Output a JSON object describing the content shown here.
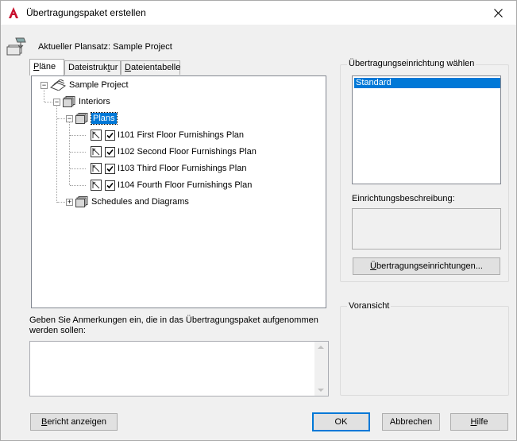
{
  "window": {
    "title": "Übertragungspaket erstellen",
    "accent": "#0078d7",
    "app_icon_color": "#c8102e"
  },
  "header": {
    "label": "Aktueller Plansatz: Sample Project"
  },
  "tabs": [
    {
      "label": "Pläne",
      "underline_char": "P",
      "rest": "läne",
      "active": true
    },
    {
      "label": "Dateistruktur",
      "pre": "Dateistruk",
      "underline_char": "t",
      "rest": "ur",
      "active": false
    },
    {
      "label": "Dateientabelle",
      "pre": "",
      "underline_char": "D",
      "rest": "ateientabelle",
      "active": false
    }
  ],
  "tree": {
    "root": "Sample Project",
    "interiors": "Interiors",
    "plans": "Plans",
    "sheets": [
      {
        "label": "I101 First Floor Furnishings Plan",
        "checked": true
      },
      {
        "label": "I102 Second Floor Furnishings Plan",
        "checked": true
      },
      {
        "label": "I103 Third Floor Furnishings Plan",
        "checked": true
      },
      {
        "label": "I104 Fourth Floor Furnishings Plan",
        "checked": true
      }
    ],
    "schedules": "Schedules and Diagrams"
  },
  "notes": {
    "label": "Geben Sie Anmerkungen ein, die in das Übertragungspaket aufgenommen werden sollen:",
    "value": ""
  },
  "setup": {
    "group_title": "Übertragungseinrichtung wählen",
    "selected": "Standard",
    "desc_label": "Einrichtungsbeschreibung:",
    "desc_value": "",
    "button_label": "Übertragungseinrichtungen...",
    "button_underline": "Ü",
    "button_rest": "bertragungseinrichtungen..."
  },
  "preview": {
    "group_title": "Voransicht"
  },
  "footer": {
    "report_pre": "",
    "report_u": "B",
    "report_rest": "ericht anzeigen",
    "ok": "OK",
    "cancel": "Abbrechen",
    "help_pre": "",
    "help_u": "H",
    "help_rest": "ilfe"
  }
}
